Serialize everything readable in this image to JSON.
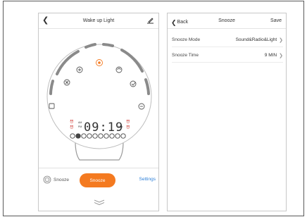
{
  "left_screen": {
    "title": "Wake up Light",
    "display": {
      "am": "AM",
      "pm": "PM",
      "time": "09:19",
      "min": "MIN"
    },
    "bottom": {
      "snooze_label": "Snooze",
      "snooze_button": "Snooze",
      "settings_label": "Settings"
    },
    "accent_color": "#f47a20",
    "link_color": "#2d7fd8"
  },
  "right_screen": {
    "back_label": "Back",
    "title": "Snooze",
    "save_label": "Save",
    "rows": [
      {
        "label": "Snooze Mode",
        "value": "Sound&Radio&Light"
      },
      {
        "label": "Snooze Time",
        "value": "9 MIN"
      }
    ]
  }
}
